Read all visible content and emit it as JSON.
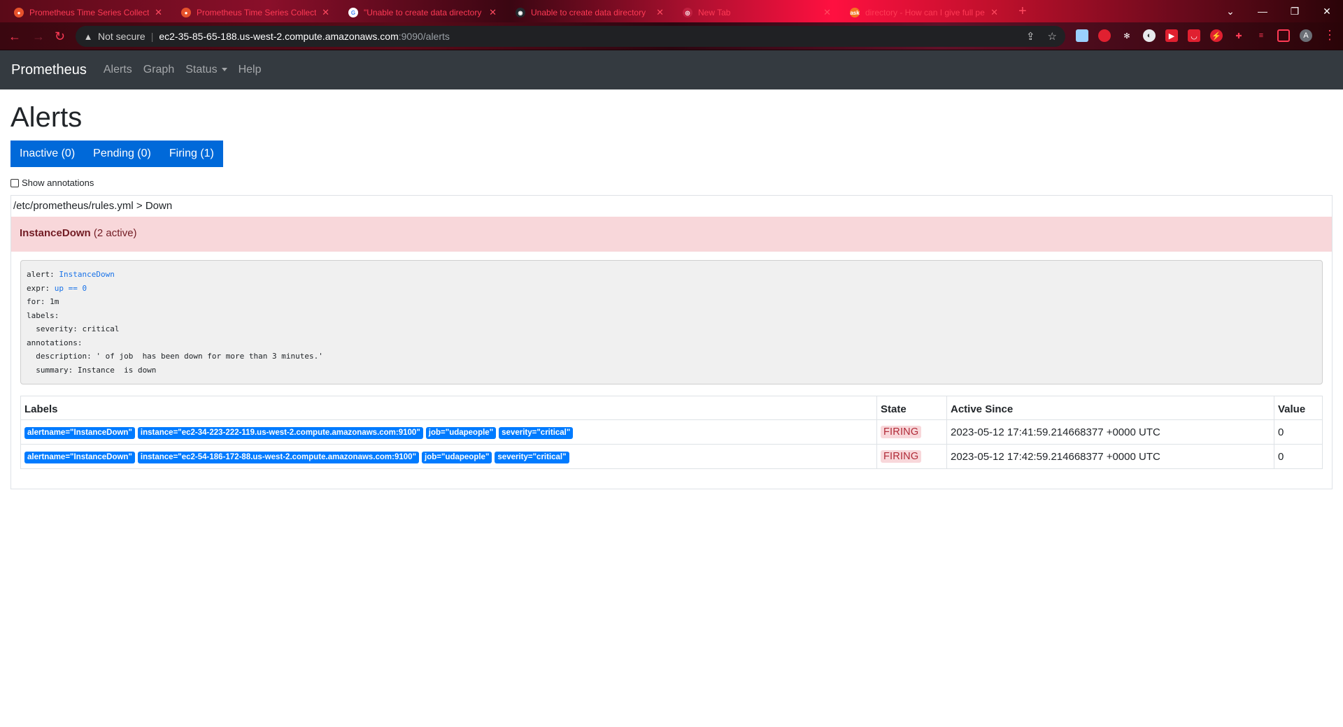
{
  "browser": {
    "tabs": [
      {
        "title": "Prometheus Time Series Collecti",
        "favicon": "prometheus-icon"
      },
      {
        "title": "Prometheus Time Series Collecti",
        "favicon": "prometheus-icon"
      },
      {
        "title": "\"Unable to create data directory",
        "favicon": "google-icon"
      },
      {
        "title": "Unable to create data directory",
        "favicon": "github-icon"
      },
      {
        "title": "New Tab",
        "favicon": "chrome-icon"
      },
      {
        "title": "directory - How can I give full pe",
        "favicon": "askubuntu-icon"
      }
    ],
    "address": {
      "security": "Not secure",
      "host": "ec2-35-85-65-188.us-west-2.compute.amazonaws.com",
      "path": ":9090/alerts"
    },
    "profile_initial": "A",
    "accent_color": "#ff3a55"
  },
  "navbar": {
    "brand": "Prometheus",
    "links": [
      "Alerts",
      "Graph",
      "Status",
      "Help"
    ]
  },
  "page": {
    "title": "Alerts",
    "filters": [
      "Inactive (0)",
      "Pending (0)",
      "Firing (1)"
    ],
    "show_annotations": "Show annotations",
    "rule_group": "/etc/prometheus/rules.yml > Down",
    "alert": {
      "name": "InstanceDown",
      "count": "(2 active)"
    },
    "rule": {
      "alert_key": "alert: ",
      "alert_val": "InstanceDown",
      "expr_key": "expr: ",
      "expr_val": "up == 0",
      "for_line": "for: 1m",
      "labels_line": "labels:",
      "severity_line": "  severity: critical",
      "annotations_line": "annotations:",
      "description_line": "  description: ' of job  has been down for more than 3 minutes.'",
      "summary_line": "  summary: Instance  is down"
    },
    "table": {
      "headers": [
        "Labels",
        "State",
        "Active Since",
        "Value"
      ],
      "rows": [
        {
          "labels": [
            "alertname=\"InstanceDown\"",
            "instance=\"ec2-34-223-222-119.us-west-2.compute.amazonaws.com:9100\"",
            "job=\"udapeople\"",
            "severity=\"critical\""
          ],
          "state": "FIRING",
          "active_since": "2023-05-12 17:41:59.214668377 +0000 UTC",
          "value": "0"
        },
        {
          "labels": [
            "alertname=\"InstanceDown\"",
            "instance=\"ec2-54-186-172-88.us-west-2.compute.amazonaws.com:9100\"",
            "job=\"udapeople\"",
            "severity=\"critical\""
          ],
          "state": "FIRING",
          "active_since": "2023-05-12 17:42:59.214668377 +0000 UTC",
          "value": "0"
        }
      ]
    }
  }
}
